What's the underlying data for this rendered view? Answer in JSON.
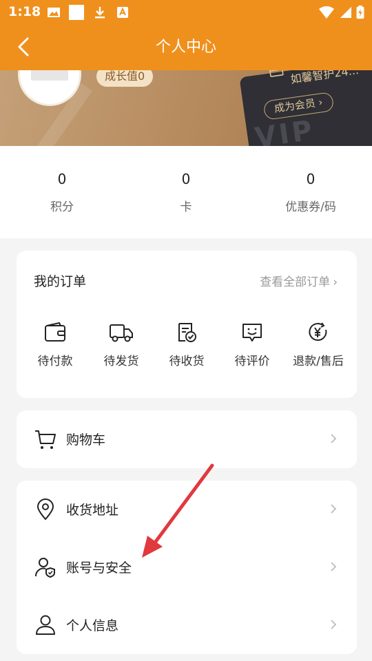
{
  "status_bar": {
    "time": "1:18"
  },
  "header": {
    "title": "个人中心"
  },
  "banner": {
    "growth_label": "成长值0",
    "vip_text": "如馨智护24...",
    "vip_button": "成为会员",
    "vip_card_text": "VIP"
  },
  "stats": [
    {
      "value": "0",
      "label": "积分"
    },
    {
      "value": "0",
      "label": "卡"
    },
    {
      "value": "0",
      "label": "优惠券/码"
    }
  ],
  "orders": {
    "title": "我的订单",
    "view_all": "查看全部订单",
    "chevron": "›",
    "items": [
      {
        "label": "待付款",
        "icon": "wallet-icon"
      },
      {
        "label": "待发货",
        "icon": "truck-icon"
      },
      {
        "label": "待收货",
        "icon": "receipt-check-icon"
      },
      {
        "label": "待评价",
        "icon": "review-smile-icon"
      },
      {
        "label": "退款/售后",
        "icon": "refund-yen-icon"
      }
    ]
  },
  "menu": {
    "cart": {
      "label": "购物车",
      "icon": "cart-icon"
    },
    "address": {
      "label": "收货地址",
      "icon": "location-pin-icon"
    },
    "account": {
      "label": "账号与安全",
      "icon": "user-shield-icon"
    },
    "profile": {
      "label": "个人信息",
      "icon": "user-icon"
    }
  },
  "colors": {
    "header_bg": "#f0901c",
    "annotation_arrow": "#e0393e"
  }
}
